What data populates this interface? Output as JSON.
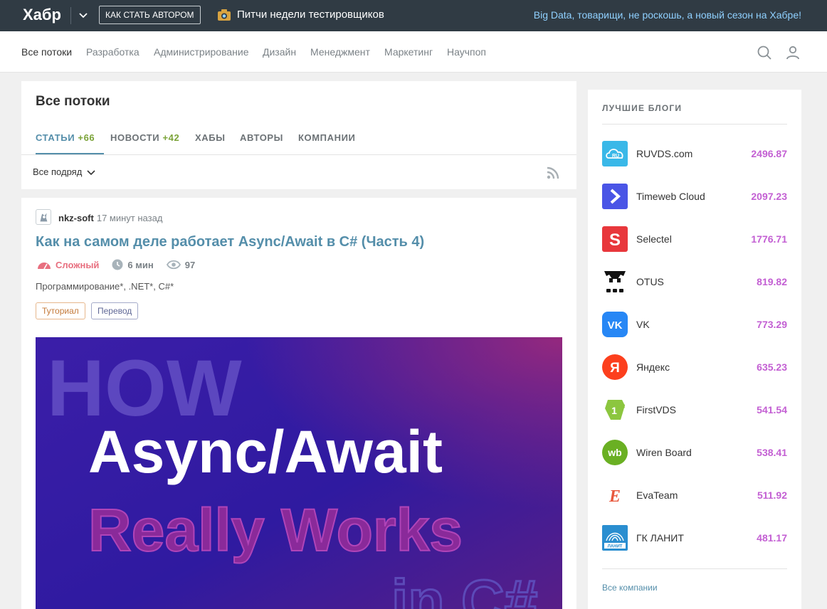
{
  "header": {
    "logo": "Хабр",
    "become_author": "КАК СТАТЬ АВТОРОМ",
    "promo": "Питчи недели тестировщиков",
    "banner": "Big Data, товарищи, не роскошь, а новый сезон на Хабре!"
  },
  "nav": {
    "items": [
      "Все потоки",
      "Разработка",
      "Администрирование",
      "Дизайн",
      "Менеджмент",
      "Маркетинг",
      "Научпоп"
    ]
  },
  "page": {
    "title": "Все потоки",
    "tabs": [
      {
        "label": "СТАТЬИ",
        "count": "+66"
      },
      {
        "label": "НОВОСТИ",
        "count": "+42"
      },
      {
        "label": "ХАБЫ",
        "count": ""
      },
      {
        "label": "АВТОРЫ",
        "count": ""
      },
      {
        "label": "КОМПАНИИ",
        "count": ""
      }
    ],
    "filter": "Все подряд"
  },
  "article": {
    "author": "nkz-soft",
    "time": "17 минут назад",
    "title": "Как на самом деле работает Async/Await в C# (Часть 4)",
    "difficulty": "Сложный",
    "read_time": "6 мин",
    "views": "97",
    "hubs": [
      "Программирование*",
      ".NET*",
      "C#*"
    ],
    "labels": [
      "Туториал",
      "Перевод"
    ],
    "cover": {
      "line1": "HOW",
      "line2": "Async/Await",
      "line3": "Really Works",
      "line4": "in C#"
    }
  },
  "sidebar": {
    "title": "ЛУЧШИЕ БЛОГИ",
    "blogs": [
      {
        "name": "RUVDS.com",
        "rating": "2496.87",
        "icon": "ruvds-logo",
        "color": "#3ab8e8"
      },
      {
        "name": "Timeweb Cloud",
        "rating": "2097.23",
        "icon": "timeweb-logo",
        "color": "#4a55e6"
      },
      {
        "name": "Selectel",
        "rating": "1776.71",
        "icon": "selectel-logo",
        "color": "#e8373c"
      },
      {
        "name": "OTUS",
        "rating": "819.82",
        "icon": "otus-logo",
        "color": "#111111"
      },
      {
        "name": "VK",
        "rating": "773.29",
        "icon": "vk-logo",
        "color": "#2787f5"
      },
      {
        "name": "Яндекс",
        "rating": "635.23",
        "icon": "yandex-logo",
        "color": "#fc3f1d"
      },
      {
        "name": "FirstVDS",
        "rating": "541.54",
        "icon": "firstvds-logo",
        "color": "#8cc63f"
      },
      {
        "name": "Wiren Board",
        "rating": "538.41",
        "icon": "wirenboard-logo",
        "color": "#6ab023"
      },
      {
        "name": "EvaTeam",
        "rating": "511.92",
        "icon": "evateam-logo",
        "color": "#e8573c"
      },
      {
        "name": "ГК ЛАНИТ",
        "rating": "481.17",
        "icon": "lanit-logo",
        "color": "#2a8ed0"
      }
    ],
    "all_companies": "Все компании"
  },
  "colors": {
    "topbar": "#303b44",
    "link": "#548eaa",
    "rating": "#c35fd3",
    "count": "#7ba338",
    "difficulty": "#e86f7f"
  }
}
